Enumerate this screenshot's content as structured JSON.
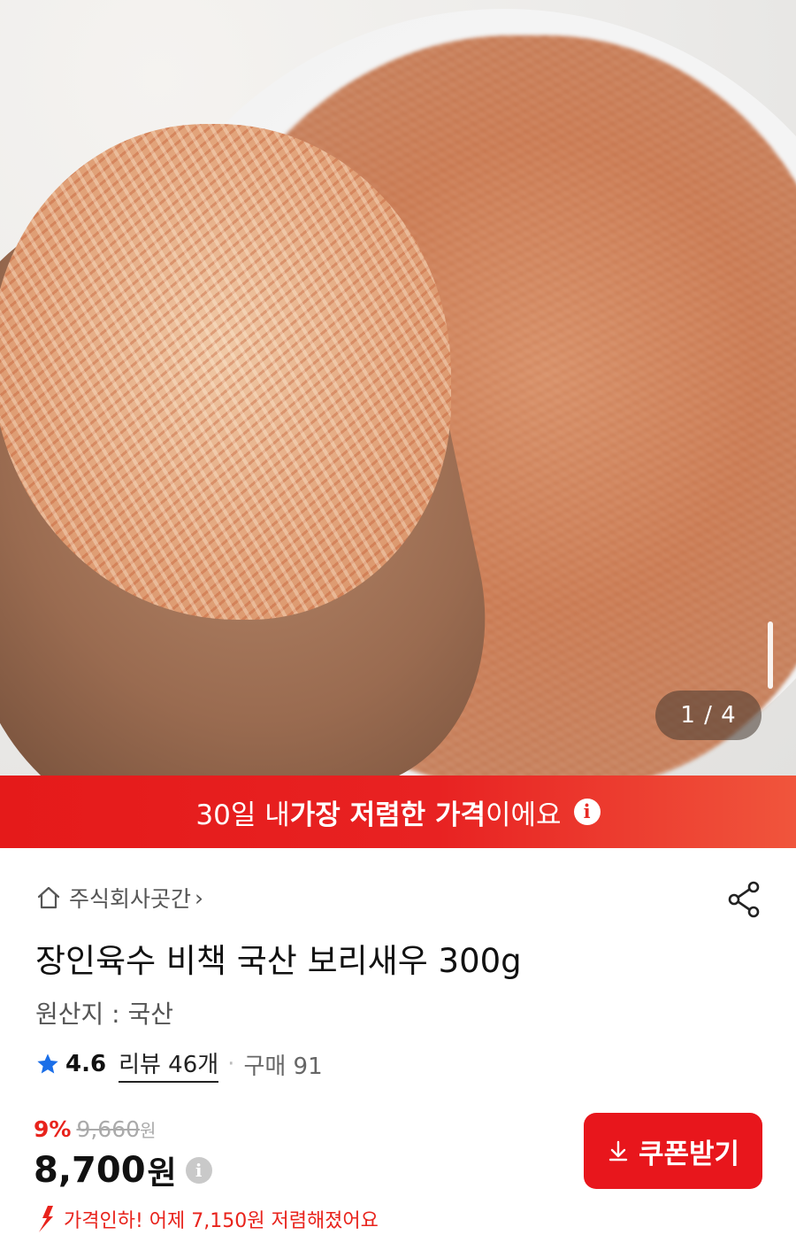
{
  "gallery": {
    "page_counter": "1 / 4",
    "current_page": 1,
    "total_pages": 4
  },
  "promo": {
    "prefix": "30일 내 ",
    "highlight": "가장 저렴한 가격",
    "suffix": "이에요",
    "info_icon_glyph": "i"
  },
  "store": {
    "name": "주식회사곳간",
    "chevron": "›"
  },
  "product": {
    "title": "장인육수 비책 국산 보리새우 300g",
    "origin": "원산지 : 국산"
  },
  "rating": {
    "score": "4.6",
    "reviews": "리뷰 46개",
    "separator": "·",
    "purchases": "구매 91",
    "star_color": "#1a6ee8"
  },
  "pricing": {
    "discount_rate": "9%",
    "original_price": "9,660",
    "original_unit": "원",
    "price": "8,700",
    "price_unit": "원",
    "info_icon_glyph": "i"
  },
  "coupon_button": {
    "label": "쿠폰받기"
  },
  "price_drop": {
    "text": "가격인하! 어제 7,150원 저렴해졌어요"
  },
  "colors": {
    "accent_red": "#e8161c",
    "muted_gray": "#555555"
  }
}
